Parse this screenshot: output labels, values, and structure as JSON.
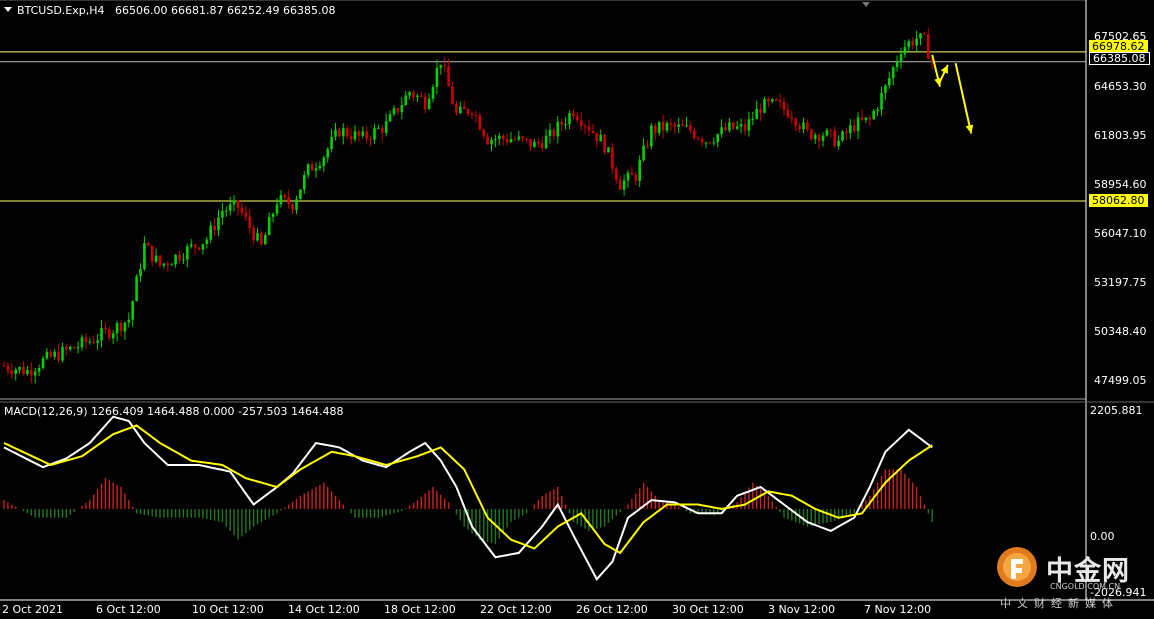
{
  "header": {
    "symbol": "BTCUSD.Exp,H4",
    "open": "66506.00",
    "high": "66681.87",
    "low": "66252.49",
    "close": "66385.08"
  },
  "macd_header": {
    "label": "MACD(12,26,9)",
    "values": "1266.409 1464.488 0.000 -257.503 1464.488"
  },
  "price_axis": {
    "ticks": [
      "67502.65",
      "64653.30",
      "61803.95",
      "58954.60",
      "56047.10",
      "53197.75",
      "50348.40",
      "47499.05"
    ],
    "badges": [
      {
        "value": "66978.62",
        "bg": "#ffff00",
        "fg": "#000000"
      },
      {
        "value": "66385.08",
        "bg": "#000000",
        "fg": "#ffffff"
      },
      {
        "value": "58062.80",
        "bg": "#ffff00",
        "fg": "#000000"
      }
    ]
  },
  "macd_axis": {
    "ticks": [
      "2205.881",
      "0.00",
      "-2026.941"
    ]
  },
  "time_axis": {
    "labels": [
      "2 Oct 2021",
      "6 Oct 12:00",
      "10 Oct 12:00",
      "14 Oct 12:00",
      "18 Oct 12:00",
      "22 Oct 12:00",
      "26 Oct 12:00",
      "30 Oct 12:00",
      "3 Nov 12:00",
      "7 Nov 12:00"
    ]
  },
  "watermark": {
    "name": "中金网",
    "url": "CNGOLD.COM.CN",
    "sub": "中文财经新媒体"
  },
  "colors": {
    "bull": "#00d000",
    "bear": "#cc0000",
    "level": "#ffff66",
    "macd_line": "#ffffff",
    "signal_line": "#ffff00",
    "hist_pos": "#cc2222",
    "hist_neg": "#227722"
  },
  "chart_data": [
    {
      "type": "candlestick",
      "title": "BTCUSD.Exp,H4",
      "x_range": [
        "2 Oct 2021",
        "9 Nov 2021"
      ],
      "ylim": [
        46400,
        69600
      ],
      "horizontal_levels": [
        66978.62,
        66385.08,
        58062.8
      ],
      "anchors": [
        [
          0,
          48200
        ],
        [
          6,
          47900
        ],
        [
          10,
          48500
        ],
        [
          15,
          49000
        ],
        [
          22,
          49700
        ],
        [
          28,
          50400
        ],
        [
          32,
          51000
        ],
        [
          36,
          55400
        ],
        [
          40,
          54200
        ],
        [
          46,
          55000
        ],
        [
          52,
          55800
        ],
        [
          56,
          57500
        ],
        [
          60,
          57700
        ],
        [
          66,
          55300
        ],
        [
          70,
          58100
        ],
        [
          74,
          57900
        ],
        [
          78,
          59900
        ],
        [
          82,
          60800
        ],
        [
          86,
          62300
        ],
        [
          92,
          61800
        ],
        [
          98,
          62600
        ],
        [
          104,
          64600
        ],
        [
          108,
          64000
        ],
        [
          112,
          66500
        ],
        [
          116,
          63200
        ],
        [
          120,
          63600
        ],
        [
          124,
          61800
        ],
        [
          130,
          61800
        ],
        [
          136,
          61400
        ],
        [
          140,
          61900
        ],
        [
          146,
          63500
        ],
        [
          150,
          62500
        ],
        [
          154,
          61400
        ],
        [
          158,
          59100
        ],
        [
          162,
          59600
        ],
        [
          166,
          62300
        ],
        [
          170,
          62500
        ],
        [
          176,
          62300
        ],
        [
          180,
          61700
        ],
        [
          186,
          62400
        ],
        [
          190,
          62400
        ],
        [
          194,
          63700
        ],
        [
          198,
          63800
        ],
        [
          202,
          63300
        ],
        [
          206,
          62100
        ],
        [
          210,
          62100
        ],
        [
          214,
          61600
        ],
        [
          218,
          62600
        ],
        [
          222,
          62900
        ],
        [
          226,
          64800
        ],
        [
          230,
          67200
        ],
        [
          234,
          67800
        ],
        [
          236,
          67600
        ],
        [
          238,
          66400
        ]
      ],
      "forecast_arrows": [
        {
          "from": [
            238,
            66800
          ],
          "to": [
            240,
            64900
          ]
        },
        {
          "from": [
            240,
            65200
          ],
          "to": [
            242,
            66200
          ]
        },
        {
          "from": [
            244,
            66300
          ],
          "to": [
            248,
            62100
          ]
        }
      ]
    },
    {
      "type": "line",
      "title": "MACD(12,26,9)",
      "ylim": [
        -2026.941,
        2205.881
      ],
      "series": [
        {
          "name": "MACD",
          "anchors": [
            [
              0,
              1400
            ],
            [
              10,
              950
            ],
            [
              16,
              1150
            ],
            [
              22,
              1500
            ],
            [
              28,
              2100
            ],
            [
              32,
              2000
            ],
            [
              36,
              1500
            ],
            [
              42,
              1000
            ],
            [
              50,
              1000
            ],
            [
              58,
              850
            ],
            [
              64,
              100
            ],
            [
              70,
              500
            ],
            [
              74,
              800
            ],
            [
              80,
              1500
            ],
            [
              86,
              1400
            ],
            [
              92,
              1100
            ],
            [
              98,
              950
            ],
            [
              104,
              1300
            ],
            [
              108,
              1500
            ],
            [
              112,
              1100
            ],
            [
              116,
              500
            ],
            [
              120,
              -400
            ],
            [
              126,
              -1100
            ],
            [
              132,
              -1000
            ],
            [
              138,
              -400
            ],
            [
              142,
              100
            ],
            [
              146,
              -600
            ],
            [
              152,
              -1600
            ],
            [
              156,
              -1200
            ],
            [
              160,
              -200
            ],
            [
              166,
              200
            ],
            [
              172,
              150
            ],
            [
              178,
              -100
            ],
            [
              184,
              -100
            ],
            [
              188,
              300
            ],
            [
              194,
              500
            ],
            [
              200,
              100
            ],
            [
              206,
              -300
            ],
            [
              212,
              -500
            ],
            [
              218,
              -200
            ],
            [
              222,
              500
            ],
            [
              226,
              1300
            ],
            [
              232,
              1800
            ],
            [
              238,
              1400
            ]
          ]
        },
        {
          "name": "Signal",
          "anchors": [
            [
              0,
              1500
            ],
            [
              12,
              1000
            ],
            [
              20,
              1200
            ],
            [
              28,
              1700
            ],
            [
              34,
              1900
            ],
            [
              40,
              1500
            ],
            [
              48,
              1100
            ],
            [
              56,
              1000
            ],
            [
              62,
              700
            ],
            [
              70,
              500
            ],
            [
              76,
              900
            ],
            [
              84,
              1300
            ],
            [
              90,
              1200
            ],
            [
              98,
              1000
            ],
            [
              106,
              1200
            ],
            [
              112,
              1400
            ],
            [
              118,
              900
            ],
            [
              124,
              -200
            ],
            [
              130,
              -700
            ],
            [
              136,
              -900
            ],
            [
              142,
              -400
            ],
            [
              148,
              -100
            ],
            [
              154,
              -800
            ],
            [
              158,
              -1000
            ],
            [
              164,
              -300
            ],
            [
              170,
              100
            ],
            [
              178,
              100
            ],
            [
              184,
              0
            ],
            [
              190,
              100
            ],
            [
              196,
              400
            ],
            [
              202,
              300
            ],
            [
              208,
              0
            ],
            [
              214,
              -200
            ],
            [
              220,
              -100
            ],
            [
              226,
              600
            ],
            [
              232,
              1100
            ],
            [
              238,
              1450
            ]
          ]
        }
      ],
      "histogram_anchors": [
        [
          0,
          200
        ],
        [
          8,
          -200
        ],
        [
          16,
          -200
        ],
        [
          22,
          200
        ],
        [
          26,
          700
        ],
        [
          30,
          500
        ],
        [
          34,
          -100
        ],
        [
          40,
          -200
        ],
        [
          46,
          -200
        ],
        [
          50,
          -200
        ],
        [
          56,
          -300
        ],
        [
          60,
          -700
        ],
        [
          64,
          -400
        ],
        [
          70,
          -100
        ],
        [
          76,
          300
        ],
        [
          82,
          600
        ],
        [
          86,
          200
        ],
        [
          90,
          -200
        ],
        [
          96,
          -200
        ],
        [
          102,
          -50
        ],
        [
          106,
          200
        ],
        [
          110,
          500
        ],
        [
          114,
          150
        ],
        [
          118,
          -400
        ],
        [
          122,
          -700
        ],
        [
          126,
          -800
        ],
        [
          130,
          -300
        ],
        [
          134,
          -100
        ],
        [
          138,
          300
        ],
        [
          142,
          500
        ],
        [
          146,
          -300
        ],
        [
          150,
          -500
        ],
        [
          154,
          -400
        ],
        [
          160,
          100
        ],
        [
          164,
          600
        ],
        [
          168,
          200
        ],
        [
          172,
          100
        ],
        [
          176,
          -100
        ],
        [
          182,
          -150
        ],
        [
          188,
          150
        ],
        [
          192,
          600
        ],
        [
          196,
          300
        ],
        [
          200,
          -200
        ],
        [
          206,
          -400
        ],
        [
          212,
          -300
        ],
        [
          218,
          -100
        ],
        [
          222,
          300
        ],
        [
          226,
          900
        ],
        [
          230,
          900
        ],
        [
          234,
          500
        ],
        [
          238,
          -300
        ]
      ]
    }
  ]
}
